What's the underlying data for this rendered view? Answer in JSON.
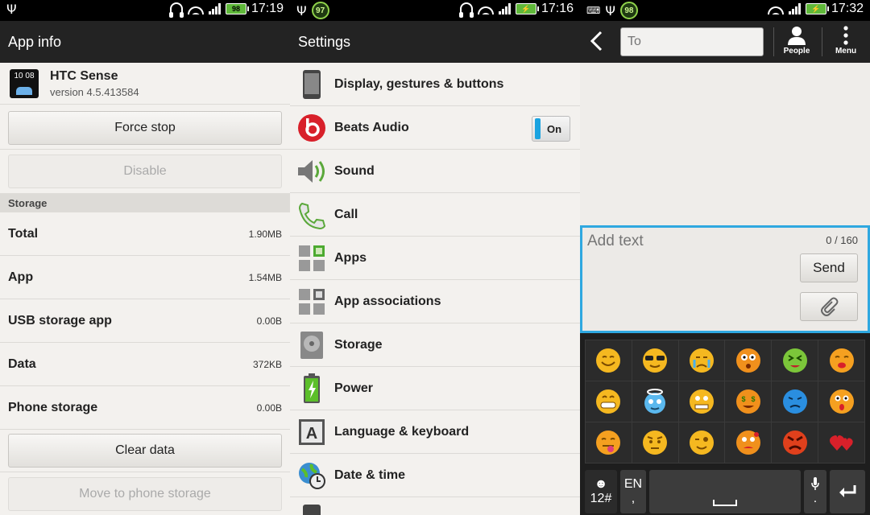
{
  "panel1": {
    "status": {
      "time": "17:19",
      "battery": "98"
    },
    "title": "App info",
    "app": {
      "name": "HTC Sense",
      "version": "version 4.5.413584",
      "icon_time": "10 08"
    },
    "force_stop": "Force stop",
    "disable": "Disable",
    "storage_header": "Storage",
    "rows": [
      {
        "label": "Total",
        "value": "1.90MB"
      },
      {
        "label": "App",
        "value": "1.54MB"
      },
      {
        "label": "USB storage app",
        "value": "0.00B"
      },
      {
        "label": "Data",
        "value": "372KB"
      },
      {
        "label": "Phone storage",
        "value": "0.00B"
      }
    ],
    "clear_data": "Clear data",
    "move": "Move to phone storage"
  },
  "panel2": {
    "status": {
      "time": "17:16",
      "battery_badge": "97"
    },
    "title": "Settings",
    "items": [
      {
        "label": "Display, gestures & buttons",
        "icon": "phone-display-icon"
      },
      {
        "label": "Beats Audio",
        "icon": "beats-audio-icon",
        "toggle": "On"
      },
      {
        "label": "Sound",
        "icon": "speaker-icon"
      },
      {
        "label": "Call",
        "icon": "phone-handset-icon"
      },
      {
        "label": "Apps",
        "icon": "apps-grid-icon"
      },
      {
        "label": "App associations",
        "icon": "app-associations-icon"
      },
      {
        "label": "Storage",
        "icon": "hard-disk-icon"
      },
      {
        "label": "Power",
        "icon": "battery-icon"
      },
      {
        "label": "Language & keyboard",
        "icon": "keyboard-a-icon"
      },
      {
        "label": "Date & time",
        "icon": "globe-clock-icon"
      }
    ],
    "accent": "#1aa3e0"
  },
  "panel3": {
    "status": {
      "time": "17:32",
      "battery_badge": "98"
    },
    "to_placeholder": "To",
    "people_label": "People",
    "menu_label": "Menu",
    "compose_placeholder": "Add text",
    "counter": "0 / 160",
    "send": "Send",
    "keys": {
      "emoji_sym": "12#",
      "lang_top": "EN",
      "lang_bottom": ","
    },
    "accent": "#2fa8e0"
  }
}
